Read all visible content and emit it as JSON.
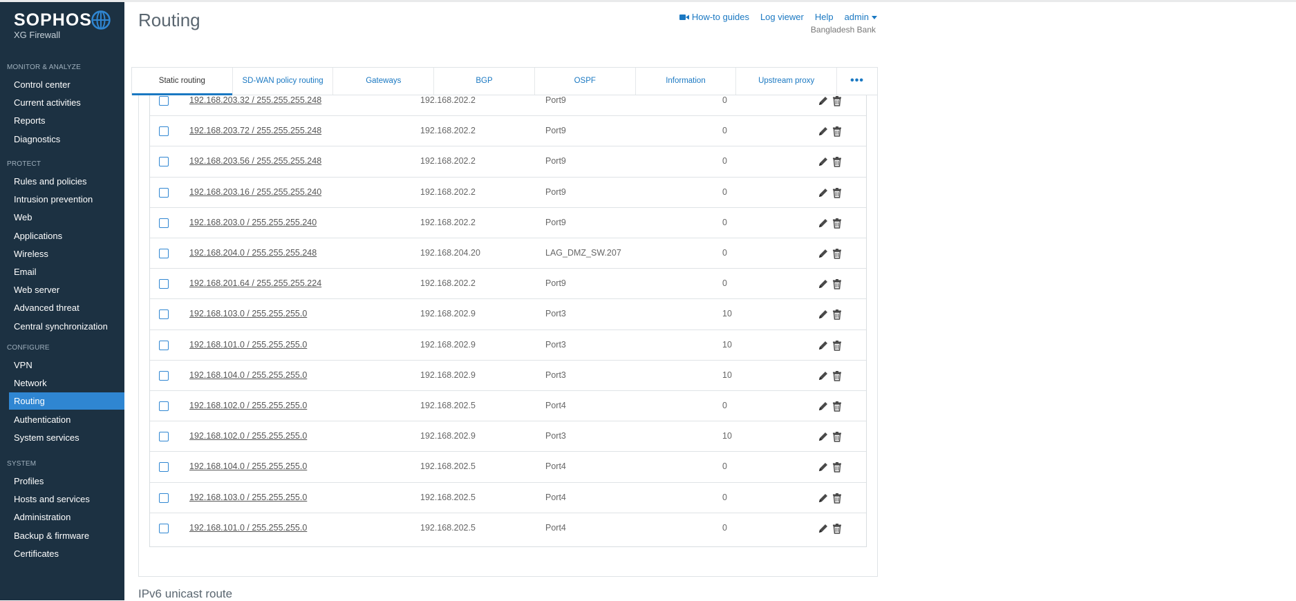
{
  "brand": {
    "name": "SOPHOS",
    "product": "XG Firewall"
  },
  "sidebar": {
    "sections": [
      {
        "title": "MONITOR & ANALYZE",
        "items": [
          "Control center",
          "Current activities",
          "Reports",
          "Diagnostics"
        ]
      },
      {
        "title": "PROTECT",
        "items": [
          "Rules and policies",
          "Intrusion prevention",
          "Web",
          "Applications",
          "Wireless",
          "Email",
          "Web server",
          "Advanced threat",
          "Central synchronization"
        ]
      },
      {
        "title": "CONFIGURE",
        "items": [
          "VPN",
          "Network",
          "Routing",
          "Authentication",
          "System services"
        ]
      },
      {
        "title": "SYSTEM",
        "items": [
          "Profiles",
          "Hosts and services",
          "Administration",
          "Backup & firmware",
          "Certificates"
        ]
      }
    ],
    "active": "Routing"
  },
  "header": {
    "title": "Routing",
    "links": [
      "How-to guides",
      "Log viewer",
      "Help",
      "admin"
    ],
    "tenant": "Bangladesh Bank"
  },
  "tabs": [
    "Static routing",
    "SD-WAN policy routing",
    "Gateways",
    "BGP",
    "OSPF",
    "Information",
    "Upstream proxy",
    "•••"
  ],
  "active_tab": "Static routing",
  "routes": [
    {
      "dest": "192.168.203.32 / 255.255.255.248",
      "gateway": "192.168.202.2",
      "interface": "Port9",
      "distance": "0"
    },
    {
      "dest": "192.168.203.72 / 255.255.255.248",
      "gateway": "192.168.202.2",
      "interface": "Port9",
      "distance": "0"
    },
    {
      "dest": "192.168.203.56 / 255.255.255.248",
      "gateway": "192.168.202.2",
      "interface": "Port9",
      "distance": "0"
    },
    {
      "dest": "192.168.203.16 / 255.255.255.240",
      "gateway": "192.168.202.2",
      "interface": "Port9",
      "distance": "0"
    },
    {
      "dest": "192.168.203.0 / 255.255.255.240",
      "gateway": "192.168.202.2",
      "interface": "Port9",
      "distance": "0"
    },
    {
      "dest": "192.168.204.0 / 255.255.255.248",
      "gateway": "192.168.204.20",
      "interface": "LAG_DMZ_SW.207",
      "distance": "0"
    },
    {
      "dest": "192.168.201.64 / 255.255.255.224",
      "gateway": "192.168.202.2",
      "interface": "Port9",
      "distance": "0"
    },
    {
      "dest": "192.168.103.0 / 255.255.255.0",
      "gateway": "192.168.202.9",
      "interface": "Port3",
      "distance": "10"
    },
    {
      "dest": "192.168.101.0 / 255.255.255.0",
      "gateway": "192.168.202.9",
      "interface": "Port3",
      "distance": "10"
    },
    {
      "dest": "192.168.104.0 / 255.255.255.0",
      "gateway": "192.168.202.9",
      "interface": "Port3",
      "distance": "10"
    },
    {
      "dest": "192.168.102.0 / 255.255.255.0",
      "gateway": "192.168.202.5",
      "interface": "Port4",
      "distance": "0"
    },
    {
      "dest": "192.168.102.0 / 255.255.255.0",
      "gateway": "192.168.202.9",
      "interface": "Port3",
      "distance": "10"
    },
    {
      "dest": "192.168.104.0 / 255.255.255.0",
      "gateway": "192.168.202.5",
      "interface": "Port4",
      "distance": "0"
    },
    {
      "dest": "192.168.103.0 / 255.255.255.0",
      "gateway": "192.168.202.5",
      "interface": "Port4",
      "distance": "0"
    },
    {
      "dest": "192.168.101.0 / 255.255.255.0",
      "gateway": "192.168.202.5",
      "interface": "Port4",
      "distance": "0"
    }
  ],
  "next_section": "IPv6 unicast route",
  "colors": {
    "sidebar_bg": "#1c3142",
    "active_nav": "#2f86d2",
    "link": "#1a78c2"
  }
}
